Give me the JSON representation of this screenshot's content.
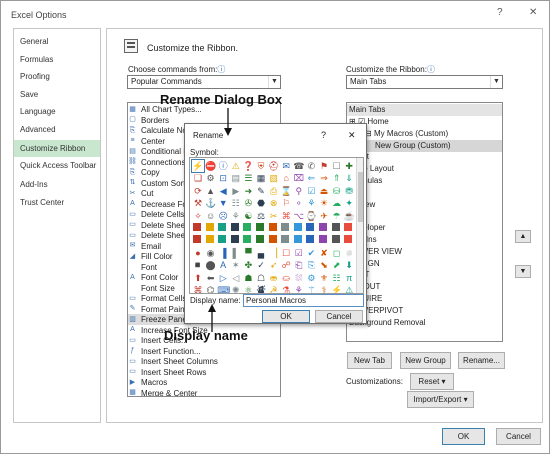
{
  "window": {
    "title": "Excel Options",
    "help": "?",
    "close": "✕"
  },
  "nav": {
    "items": [
      {
        "label": "General",
        "selected": false
      },
      {
        "label": "Formulas",
        "selected": false
      },
      {
        "label": "Proofing",
        "selected": false
      },
      {
        "label": "Save",
        "selected": false
      },
      {
        "label": "Language",
        "selected": false
      },
      {
        "label": "Advanced",
        "selected": false
      },
      {
        "label": "Customize Ribbon",
        "selected": true
      },
      {
        "label": "Quick Access Toolbar",
        "selected": false
      },
      {
        "label": "Add-Ins",
        "selected": false
      },
      {
        "label": "Trust Center",
        "selected": false
      }
    ]
  },
  "main": {
    "heading": "Customize the Ribbon.",
    "choose_label": "Choose commands from:",
    "choose_value": "Popular Commands",
    "customize_label": "Customize the Ribbon:",
    "customize_value": "Main Tabs",
    "info": "ⓘ",
    "commands": [
      "All Chart Types...",
      "Borders",
      "Calculate Now",
      "Center",
      "Conditional Formatting",
      "Connections",
      "Copy",
      "Custom Sort...",
      "Cut",
      "Decrease Font Size",
      "Delete Cells...",
      "Delete Sheet Columns",
      "Delete Sheet Rows",
      "Email",
      "Fill Color",
      "Font",
      "Font Color",
      "Font Size",
      "Format Cells",
      "Format Painter",
      "Freeze Panes",
      "Increase Font Size",
      "Insert Cells...",
      "Insert Function...",
      "Insert Sheet Columns",
      "Insert Sheet Rows",
      "Macros",
      "Merge & Center"
    ],
    "tabs_header": "Main Tabs",
    "tabs": [
      {
        "label": "Home",
        "indent": 1,
        "toggle": "⊞",
        "checked": true
      },
      {
        "label": "My Macros (Custom)",
        "indent": 2,
        "toggle": "⊟",
        "checked": null
      },
      {
        "label": "New Group (Custom)",
        "indent": 3,
        "toggle": "",
        "checked": null,
        "selected": true
      },
      {
        "label": "Insert",
        "indent": 1,
        "toggle": "",
        "checked": null
      },
      {
        "label": "Page Layout",
        "indent": 1,
        "toggle": "",
        "checked": null
      },
      {
        "label": "Formulas",
        "indent": 1,
        "toggle": "",
        "checked": null
      },
      {
        "label": "Data",
        "indent": 1,
        "toggle": "",
        "checked": null
      },
      {
        "label": "Review",
        "indent": 1,
        "toggle": "",
        "checked": null
      },
      {
        "label": "View",
        "indent": 1,
        "toggle": "",
        "checked": null
      },
      {
        "label": "Developer",
        "indent": 1,
        "toggle": "",
        "checked": null
      },
      {
        "label": "Add-Ins",
        "indent": 1,
        "toggle": "",
        "checked": null
      },
      {
        "label": "POWER VIEW",
        "indent": 1,
        "toggle": "",
        "checked": null
      },
      {
        "label": "DESIGN",
        "indent": 1,
        "toggle": "",
        "checked": null
      },
      {
        "label": "TEXT",
        "indent": 1,
        "toggle": "",
        "checked": null
      },
      {
        "label": "LAYOUT",
        "indent": 1,
        "toggle": "",
        "checked": null
      },
      {
        "label": "INQUIRE",
        "indent": 1,
        "toggle": "",
        "checked": null
      },
      {
        "label": "POWERPIVOT",
        "indent": 1,
        "toggle": "",
        "checked": null
      },
      {
        "label": "Background Removal",
        "indent": 1,
        "toggle": "",
        "checked": null
      }
    ],
    "new_tab": "New Tab",
    "new_group": "New Group",
    "rename": "Rename...",
    "customizations_label": "Customizations:",
    "reset": "Reset ▾",
    "import_export": "Import/Export ▾",
    "ok": "OK",
    "cancel": "Cancel"
  },
  "rename_dialog": {
    "title": "Rename",
    "help": "?",
    "close": "✕",
    "symbol_label": "Symbol:",
    "display_name_label": "Display name:",
    "display_name_value": "Personal Macros",
    "ok": "OK",
    "cancel": "Cancel",
    "symbols": [
      "⚡",
      "⛔",
      "ⓘ",
      "⚠",
      "❓",
      "⛨",
      "⛑",
      "✉",
      "☎",
      "✆",
      "⚑",
      "☐",
      "✚",
      "❑",
      "⚙",
      "⊡",
      "▤",
      "☰",
      "▦",
      "▧",
      "⌂",
      "⌧",
      "⇐",
      "⇒",
      "⇑",
      "⇓",
      "⟳",
      "▲",
      "◀",
      "▶",
      "➜",
      "✎",
      "⎙",
      "⌛",
      "⚲",
      "☑",
      "⏏",
      "⛁",
      "⛃",
      "⚒",
      "⚓",
      "▼",
      "☷",
      "✇",
      "⬣",
      "⊗",
      "⚐",
      "⚬",
      "⚘",
      "☀",
      "☁",
      "✦",
      "✧",
      "☺",
      "☹",
      "⚘",
      "☯",
      "⚖",
      "✂",
      "⌘",
      "⌥",
      "⌚",
      "✈",
      "☂",
      "☕",
      "⚽",
      "✪",
      "⬛",
      "■",
      "▪",
      "▫",
      "□",
      "▣",
      "▨",
      "▩",
      "■",
      "■",
      "■",
      "■",
      "■",
      "■",
      "⬚",
      "⬜",
      "◼",
      "▪",
      "◐",
      "◑",
      "◆",
      "◇",
      "○",
      "◎",
      "●",
      "◉",
      "▐",
      "▌",
      "▀",
      "▄",
      "▕",
      "☐",
      "☑",
      "✔",
      "✘",
      "◻",
      "◽",
      "◾",
      "⬤",
      "A",
      "✶",
      "✤",
      "✓",
      "➶",
      "☍",
      "⎗",
      "⎘",
      "⬊",
      "⬈",
      "⬇",
      "⬆",
      "⬅",
      "▷",
      "◁",
      "☗",
      "☖",
      "⛂",
      "⛀",
      "⛆",
      "⚙",
      "⚜",
      "☷",
      "π",
      "⌘",
      "⌬",
      "⌨",
      "✺",
      "⚛",
      "⛇",
      "☭",
      "⚗",
      "⚘",
      "⚚",
      "⚕",
      "⚡",
      "⚠",
      "⚑",
      "⚐"
    ],
    "symbol_colors": [
      "#2b7a2b",
      "#c0392b",
      "#2a66b8",
      "#e0a800",
      "#3a78c2",
      "#d24a1e",
      "#c0392b",
      "#2a66b8",
      "#555",
      "#555",
      "#c0392b",
      "#777",
      "#2b7a2b"
    ]
  },
  "annotations": {
    "rename_dialog_box": "Rename Dialog Box",
    "display_name": "Display name"
  }
}
